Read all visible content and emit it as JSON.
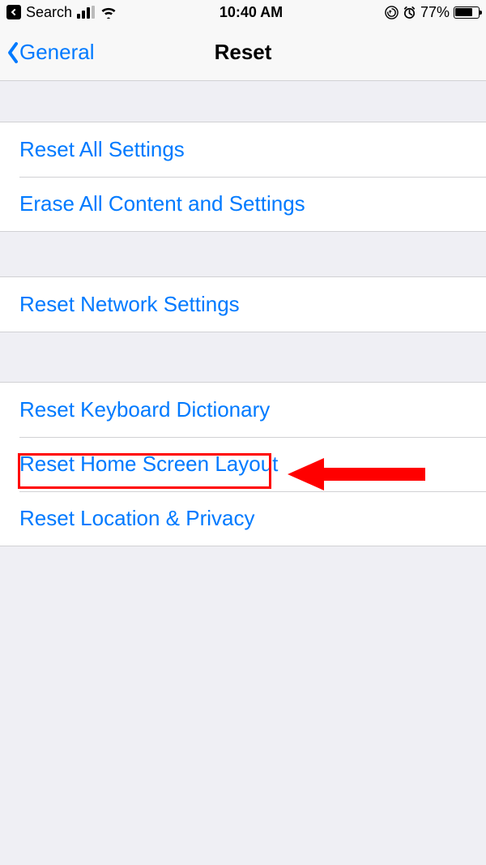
{
  "status_bar": {
    "back_app_label": "Search",
    "time": "10:40 AM",
    "battery_pct_label": "77%",
    "battery_fill_pct": 77
  },
  "nav": {
    "back_label": "General",
    "title": "Reset"
  },
  "groups": {
    "g1": {
      "row0": "Reset All Settings",
      "row1": "Erase All Content and Settings"
    },
    "g2": {
      "row0": "Reset Network Settings"
    },
    "g3": {
      "row0": "Reset Keyboard Dictionary",
      "row1": "Reset Home Screen Layout",
      "row2": "Reset Location & Privacy"
    }
  },
  "annotation": {
    "highlight_target": "reset-home-screen-layout"
  }
}
